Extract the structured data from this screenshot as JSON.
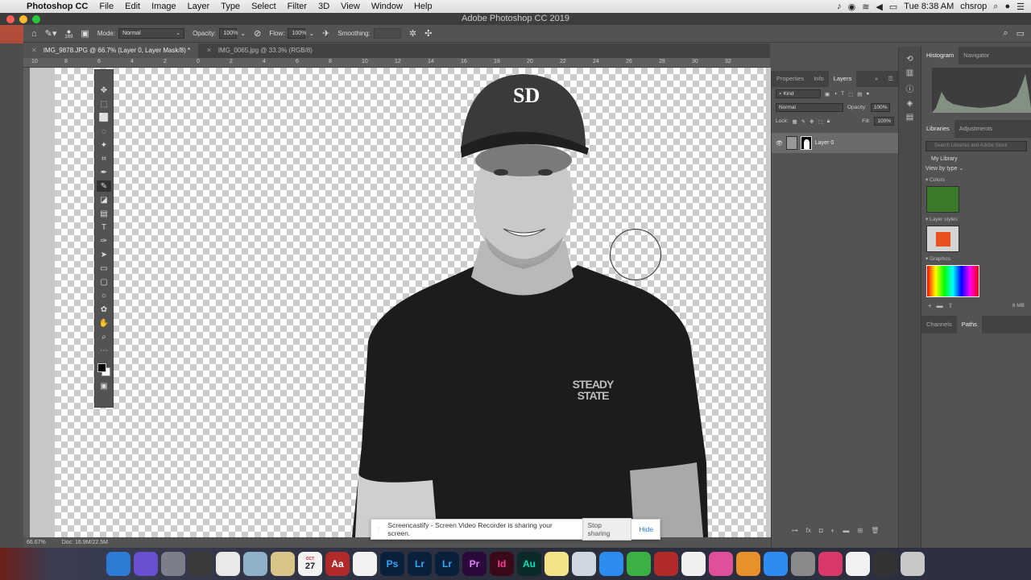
{
  "menubar": {
    "app_name": "Photoshop CC",
    "items": [
      "File",
      "Edit",
      "Image",
      "Layer",
      "Type",
      "Select",
      "Filter",
      "3D",
      "View",
      "Window",
      "Help"
    ],
    "clock": "Tue 8:38 AM",
    "user": "chsrop"
  },
  "window": {
    "title": "Adobe Photoshop CC 2019"
  },
  "options": {
    "brush_size": "169",
    "mode_label": "Mode:",
    "mode_value": "Normal",
    "opacity_label": "Opacity:",
    "opacity_value": "100%",
    "flow_label": "Flow:",
    "flow_value": "100%",
    "smoothing_label": "Smoothing:"
  },
  "tabs": [
    {
      "label": "IMG_9878.JPG @ 66.7% (Layer 0, Layer Mask/8) *"
    },
    {
      "label": "IMG_0065.jpg @ 33.3% (RGB/8)"
    }
  ],
  "ruler": [
    "10",
    "8",
    "6",
    "4",
    "2",
    "0",
    "2",
    "4",
    "6",
    "8",
    "10",
    "12",
    "14",
    "16",
    "18",
    "20",
    "22",
    "24",
    "26",
    "28",
    "30",
    "32"
  ],
  "status": {
    "zoom": "66.67%",
    "doc": "Doc: 16.9M/22.5M"
  },
  "share": {
    "message": "Screencastify - Screen Video Recorder is sharing your screen.",
    "stop": "Stop sharing",
    "hide": "Hide"
  },
  "layers_panel": {
    "tabs": [
      "Properties",
      "Info",
      "Layers"
    ],
    "kind": "Kind",
    "blend": "Normal",
    "opacity_label": "Opacity:",
    "opacity_value": "100%",
    "lock_label": "Lock:",
    "fill_label": "Fill:",
    "fill_value": "100%",
    "layer_name": "Layer 0"
  },
  "right_panel": {
    "top_tabs": [
      "Histogram",
      "Navigator"
    ],
    "lib_tabs": [
      "Libraries",
      "Adjustments"
    ],
    "search_placeholder": "Search Libraries and Adobe Stock",
    "library": "My Library",
    "view_by": "View by type",
    "colors_section": "Colors",
    "color_swatch": "#3a7a2a",
    "styles_section": "Layer styles",
    "graphics_section": "Graphics",
    "size": "6 MB",
    "bottom_tabs": [
      "Channels",
      "Paths"
    ]
  },
  "dock_apps": [
    "Finder",
    "Siri",
    "Launchpad",
    "Monitor",
    "Chrome",
    "Preview",
    "Notes",
    "Calendar",
    "Dictionary",
    "Reminders",
    "Ps",
    "Lr",
    "Lr",
    "Pr",
    "Id",
    "Au",
    "Stickies",
    "Preview2",
    "Messages",
    "FaceTime",
    "Photo Booth",
    "Photos",
    "iTunes",
    "iBooks",
    "App Store",
    "System Preferences",
    "Creative Cloud",
    "Finder2",
    "Terminal",
    "Trash"
  ],
  "calendar_day": "27",
  "calendar_month": "OCT",
  "shirt_text": "STEADY STATE",
  "cap_logo": "SD"
}
